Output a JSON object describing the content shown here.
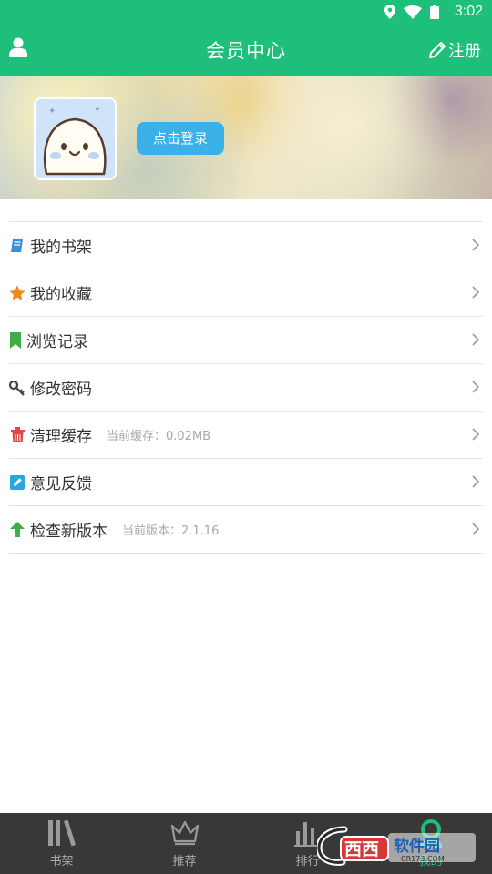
{
  "status": {
    "time": "3:02"
  },
  "header": {
    "title": "会员中心",
    "register_label": "注册"
  },
  "profile": {
    "login_label": "点击登录"
  },
  "menu": [
    {
      "label": "我的书架",
      "icon": "book-icon",
      "color": "#3a8fd8"
    },
    {
      "label": "我的收藏",
      "icon": "star-icon",
      "color": "#f08a1c"
    },
    {
      "label": "浏览记录",
      "icon": "bookmark-icon",
      "color": "#3fae4a"
    },
    {
      "label": "修改密码",
      "icon": "key-icon",
      "color": "#444444"
    },
    {
      "label": "清理缓存",
      "icon": "trash-icon",
      "color": "#e04848",
      "sub": "当前缓存：0.02MB"
    },
    {
      "label": "意见反馈",
      "icon": "edit-icon",
      "color": "#2aa6df"
    },
    {
      "label": "检查新版本",
      "icon": "arrow-up-icon",
      "color": "#3fae4a",
      "sub": "当前版本：2.1.16"
    }
  ],
  "tabs": [
    {
      "label": "书架",
      "icon": "bookshelf-icon"
    },
    {
      "label": "推荐",
      "icon": "crown-icon"
    },
    {
      "label": "排行",
      "icon": "ranking-icon"
    },
    {
      "label": "我的",
      "icon": "profile-icon"
    }
  ],
  "watermark": {
    "brand": "西西",
    "text": "软件园",
    "url": "CR173.COM"
  },
  "colors": {
    "primary": "#1dbf7a",
    "login_button": "#3bb0e9",
    "tabbar": "#383838"
  }
}
